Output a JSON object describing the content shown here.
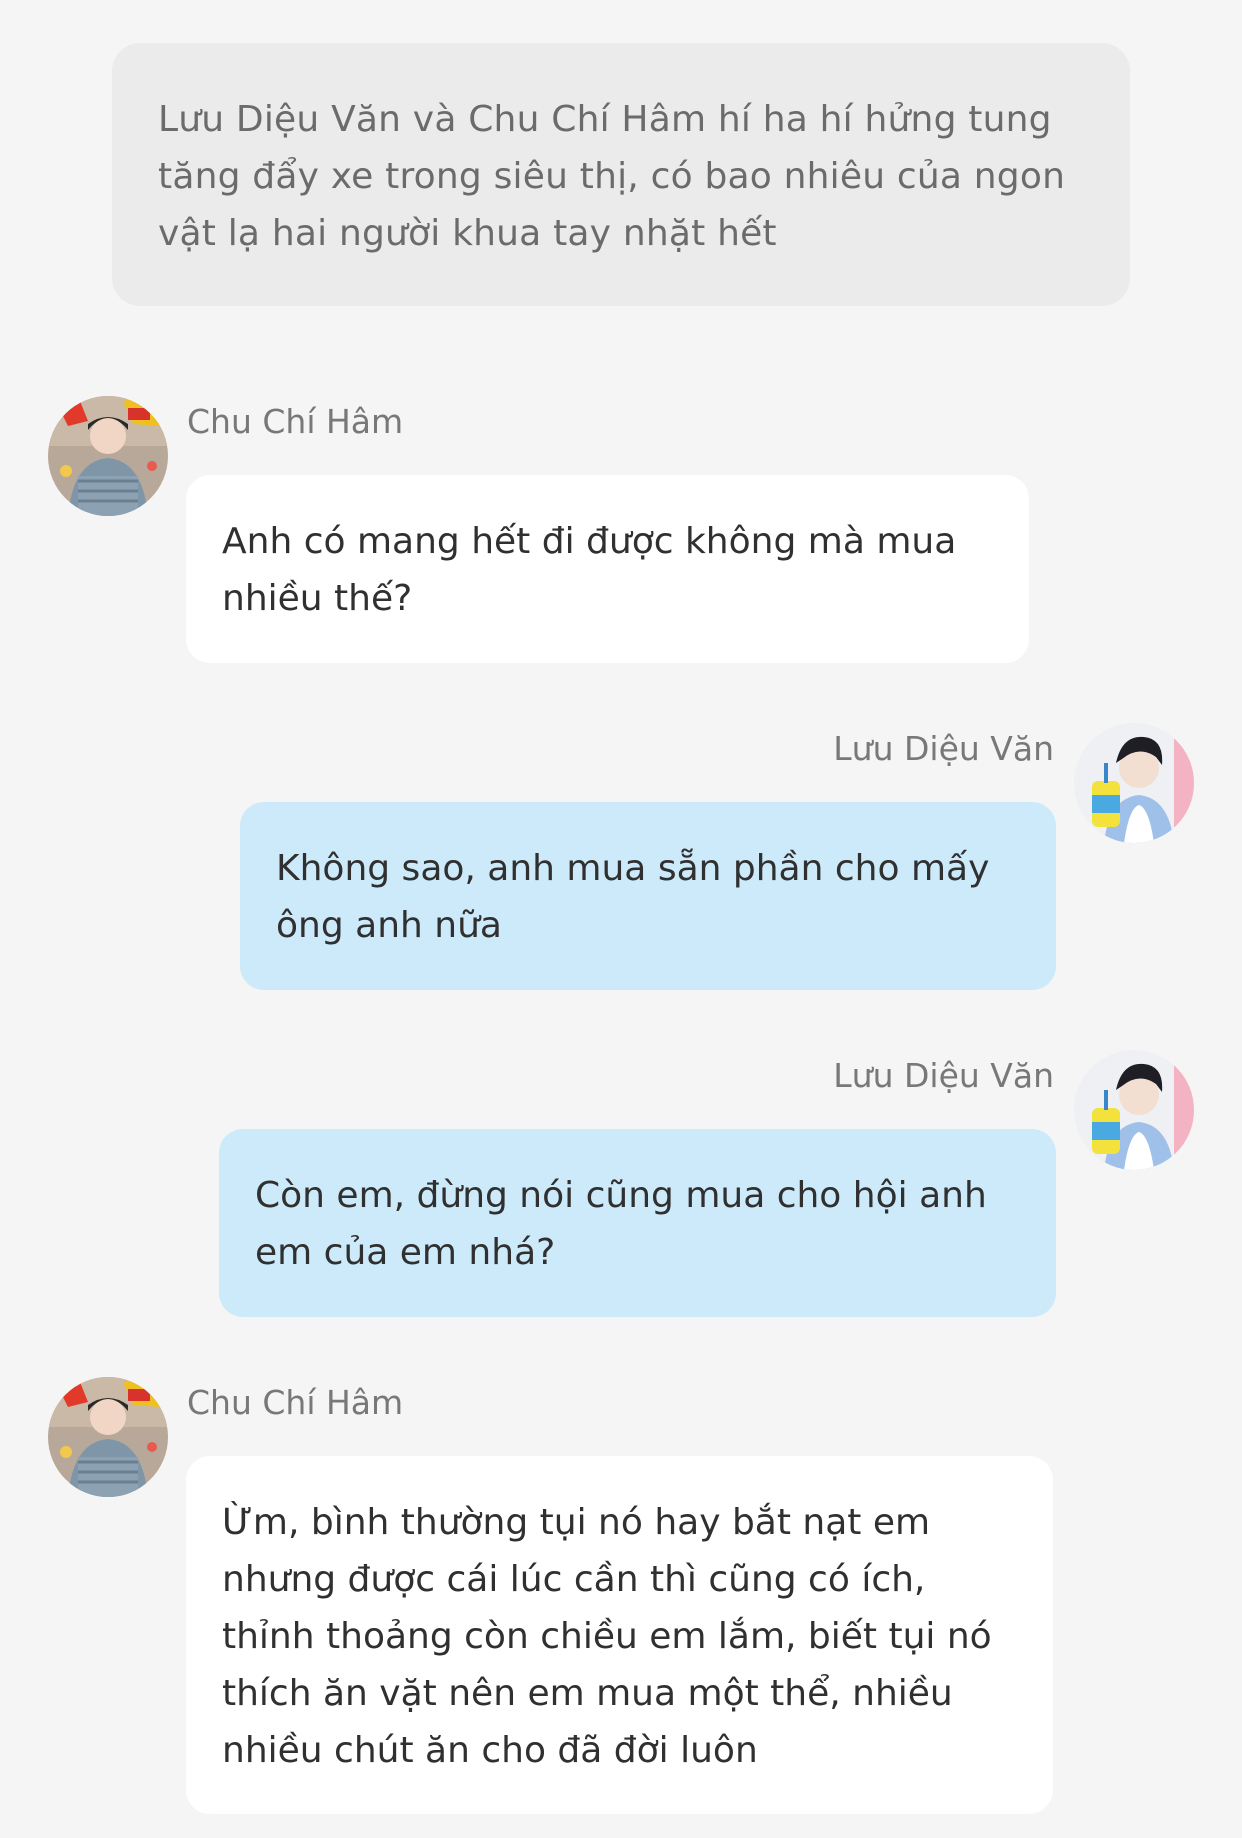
{
  "narration": {
    "text": "Lưu Diệu Văn và Chu Chí Hâm hí ha hí hửng tung tăng đẩy xe trong siêu thị, có bao nhiêu của ngon vật lạ hai người khua tay nhặt hết"
  },
  "messages": [
    {
      "sender": "Chu Chí Hâm",
      "side": "left",
      "text": "Anh có mang hết đi được không mà mua nhiều thế?"
    },
    {
      "sender": "Lưu Diệu Văn",
      "side": "right",
      "text": "Không sao, anh mua sẵn phần cho mấy ông anh nữa"
    },
    {
      "sender": "Lưu Diệu Văn",
      "side": "right",
      "text": "Còn em, đừng nói cũng mua cho hội anh em của em nhá?"
    },
    {
      "sender": "Chu Chí Hâm",
      "side": "left",
      "text": "Ừm, bình thường tụi nó hay bắt nạt em nhưng được cái lúc cần thì cũng có ích, thỉnh thoảng còn chiều em lắm, biết tụi nó thích ăn vặt nên em mua một thể, nhiều nhiều chút ăn cho đã đời luôn"
    }
  ],
  "colors": {
    "background": "#f5f5f5",
    "narration_bubble": "#ebebeb",
    "left_bubble": "#ffffff",
    "right_bubble": "#cdeafb",
    "name_text": "#787878"
  },
  "icons": {
    "left_avatar": "avatar-chu-chi-ham",
    "right_avatar": "avatar-luu-dieu-van"
  }
}
